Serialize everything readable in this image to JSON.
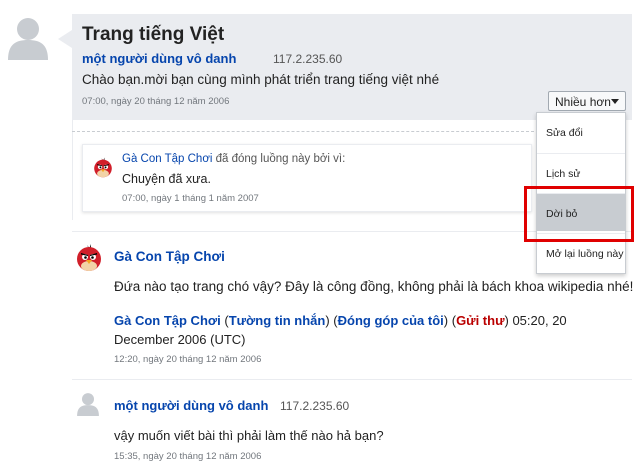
{
  "topic": {
    "title": "Trang tiếng Việt",
    "author": "một người dùng vô danh",
    "ip": "117.2.235.60",
    "body": "Chào bạn.mời bạn cùng mình phát triển trang tiếng việt nhé",
    "timestamp": "07:00, ngày 20 tháng 12 năm 2006",
    "more_button_label": "Nhiều hơn"
  },
  "menu": {
    "items": [
      "Sửa đổi",
      "Lịch sử",
      "Dời bỏ",
      "Mở lại luồng này"
    ]
  },
  "hidden_notice": {
    "user": "Gà Con Tập Chơi",
    "suffix": " đã đóng luồng này bởi vì:",
    "reason": "Chuyện đã xưa.",
    "timestamp": "07:00, ngày 1 tháng 1 năm 2007"
  },
  "post2": {
    "author": "Gà Con Tập Chơi",
    "body": "Đứa nào tạo trang chó vậy? Đây là công đồng, không phải là bách khoa wikipedia nhé!",
    "sig": {
      "name": "Gà Con Tập Chơi",
      "open1": " (",
      "wall": "Tường tin nhắn",
      "sep1": ") (",
      "contrib": "Đóng góp của tôi",
      "sep2": ") (",
      "mail": "Gửi thư",
      "close": ") 05:20, 20 December 2006 (UTC)"
    },
    "timestamp": "12:20, ngày 20 tháng 12 năm 2006"
  },
  "post3": {
    "author": "một người dùng vô danh",
    "ip": "117.2.235.60",
    "body": "vậy muốn viết bài thì phải làm thế nào hả bạn?",
    "timestamp": "15:35, ngày 20 tháng 12 năm 2006"
  },
  "colors": {
    "link": "#0645ad",
    "card_bg": "#eaecf0",
    "highlight_border": "#e00000",
    "mail_link": "#ba0000"
  },
  "icons": {
    "anon_avatar": "user-silhouette-icon",
    "bird_avatar": "angry-bird-avatar-icon",
    "dropdown": "caret-down-icon"
  }
}
